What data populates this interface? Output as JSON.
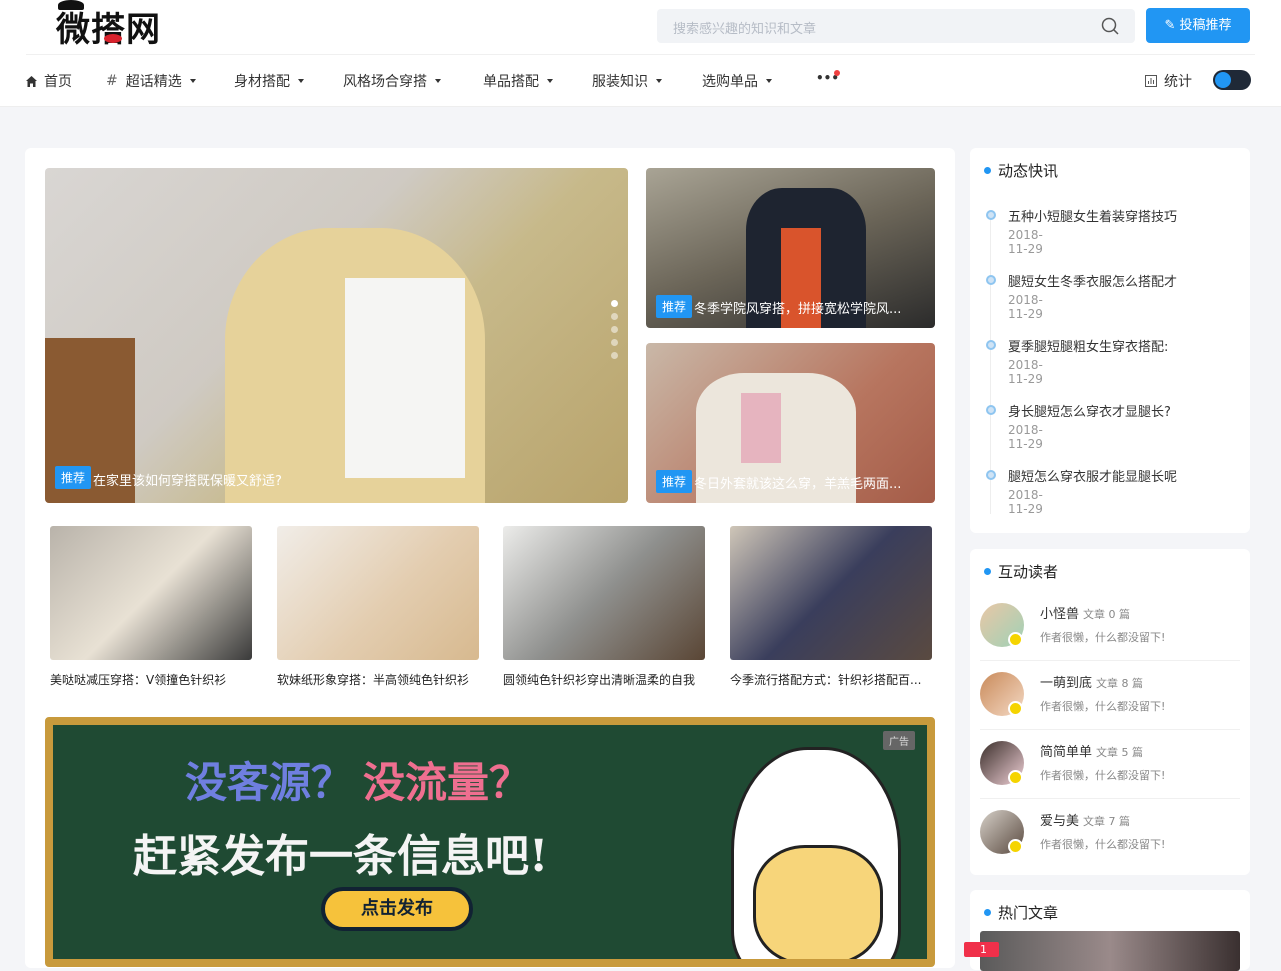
{
  "logo": {
    "text": "微搭网"
  },
  "search": {
    "placeholder": "搜索感兴趣的知识和文章"
  },
  "submit_button": {
    "label": "投稿推荐"
  },
  "nav": {
    "items": [
      {
        "label": "首页",
        "icon": "home-icon"
      },
      {
        "label": "超话精选",
        "prefix": "#"
      },
      {
        "label": "身材搭配"
      },
      {
        "label": "风格场合穿搭"
      },
      {
        "label": "单品搭配"
      },
      {
        "label": "服装知识"
      },
      {
        "label": "选购单品"
      },
      {
        "label": "•••"
      }
    ],
    "stats_label": "统计"
  },
  "slider": {
    "main": {
      "badge": "推荐",
      "title": "在家里该如何穿搭既保暖又舒适?"
    },
    "side": [
      {
        "badge": "推荐",
        "title": "冬季学院风穿搭，拼接宽松学院风..."
      },
      {
        "badge": "推荐",
        "title": "冬日外套就该这么穿，羊羔毛两面..."
      }
    ]
  },
  "cards": [
    {
      "title": "美哒哒减压穿搭：V领撞色针织衫"
    },
    {
      "title": "软妹纸形象穿搭：半高领纯色针织衫"
    },
    {
      "title": "圆领纯色针织衫穿出清晰温柔的自我"
    },
    {
      "title": "今季流行搭配方式：针织衫搭配百..."
    }
  ],
  "ad": {
    "tag": "广告",
    "line1a": "没客源？",
    "line1b": "没流量？",
    "line2": "赶紧发布一条信息吧!",
    "button": "点击发布"
  },
  "news_panel": {
    "title": "动态快讯",
    "items": [
      {
        "title": "五种小短腿女生着装穿搭技巧",
        "date": "2018-11-29"
      },
      {
        "title": "腿短女生冬季衣服怎么搭配才",
        "date": "2018-11-29"
      },
      {
        "title": "夏季腿短腿粗女生穿衣搭配:",
        "date": "2018-11-29"
      },
      {
        "title": "身长腿短怎么穿衣才显腿长?",
        "date": "2018-11-29"
      },
      {
        "title": "腿短怎么穿衣服才能显腿长呢",
        "date": "2018-11-29"
      }
    ]
  },
  "readers_panel": {
    "title": "互动读者",
    "items": [
      {
        "name": "小怪兽",
        "count": "文章 0 篇",
        "sig": "作者很懒，什么都没留下!"
      },
      {
        "name": "一萌到底",
        "count": "文章 8 篇",
        "sig": "作者很懒，什么都没留下!"
      },
      {
        "name": "简简单单",
        "count": "文章 5 篇",
        "sig": "作者很懒，什么都没留下!"
      },
      {
        "name": "爱与美",
        "count": "文章 7 篇",
        "sig": "作者很懒，什么都没留下!"
      }
    ]
  },
  "hot_panel": {
    "title": "热门文章",
    "rank": "1"
  },
  "colors": {
    "accent": "#2196f3",
    "dark": "#1f2937",
    "ad_frame": "#c89a3c",
    "ad_board": "#1f4a33"
  }
}
